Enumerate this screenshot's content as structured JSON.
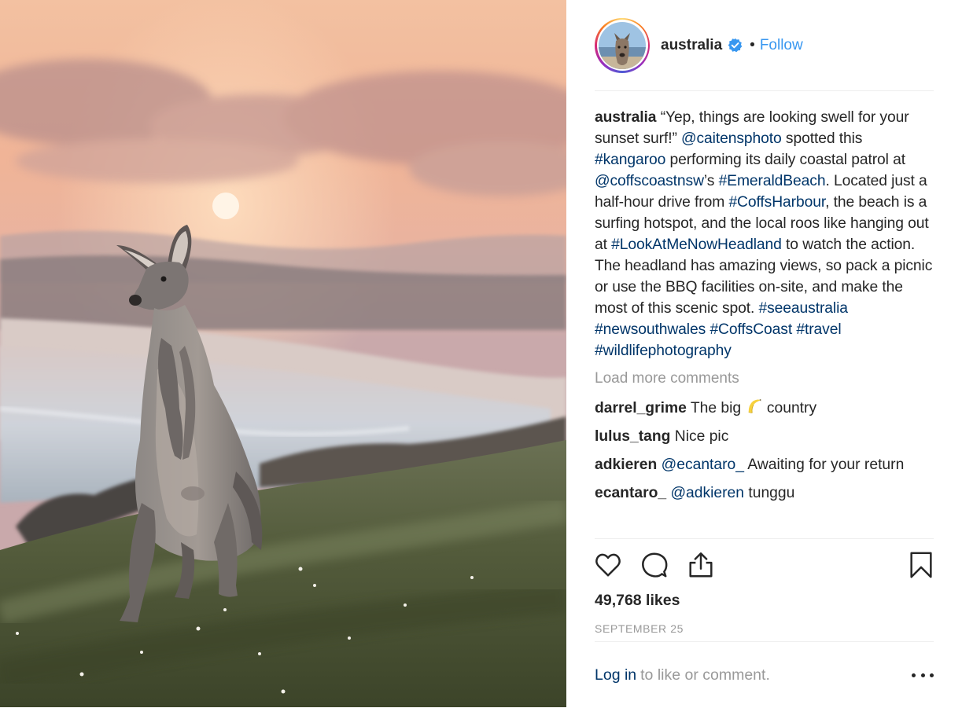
{
  "post": {
    "photo_alt": "Kangaroo standing on a grassy headland at sunset",
    "header": {
      "username": "australia",
      "separator": "•",
      "follow_label": "Follow"
    },
    "caption": {
      "username": "australia",
      "parts": [
        "“Yep, things are looking swell for your sunset surf!” ",
        "@caitensphoto",
        " spotted this ",
        "#kangaroo",
        " performing its daily coastal patrol at ",
        "@coffscoastnsw",
        "’s ",
        "#EmeraldBeach",
        ". Located just a half-hour drive from ",
        "#CoffsHarbour",
        ", the beach is a surfing hotspot, and the local roos like hanging out at ",
        "#LookAtMeNowHeadland",
        " to watch the action. The headland has amazing views, so pack a picnic or use the BBQ facilities on-site, and make the most of this scenic spot. ",
        "#seeaustralia",
        " ",
        "#newsouthwales",
        " ",
        "#CoffsCoast",
        " ",
        "#travel",
        " ",
        "#wildlifephotography"
      ]
    },
    "load_more_label": "Load more comments",
    "comments": [
      {
        "user": "darrel_grime",
        "text_before": "The big ",
        "emoji": "banana",
        "text_after": " country"
      },
      {
        "user": "lulus_tang",
        "text": "Nice pic"
      },
      {
        "user": "adkieren",
        "mention": "@ecantaro_",
        "text": " Awaiting for your return"
      },
      {
        "user": "ecantaro_",
        "mention": "@adkieren",
        "text": " tunggu"
      }
    ],
    "likes": "49,768 likes",
    "date": "SEPTEMBER 25",
    "footer": {
      "login_label": "Log in",
      "rest_label": "to like or comment."
    },
    "icons": {
      "like": "heart-icon",
      "comment": "comment-icon",
      "share": "share-icon",
      "save": "bookmark-icon",
      "more": "more-options-icon",
      "verified": "verified-badge-icon"
    },
    "colors": {
      "link": "#003569",
      "follow": "#3897f0",
      "muted": "#999999",
      "text": "#262626"
    }
  }
}
